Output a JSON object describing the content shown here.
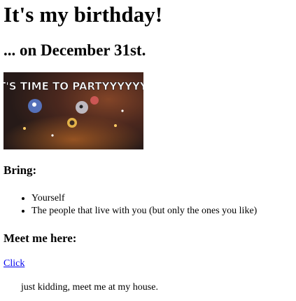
{
  "page": {
    "heading": "It's my birthday!",
    "subheading": "... on December 31st.",
    "banner": {
      "text": "IT'S TIME TO PARTYYYYYY!",
      "colors": {
        "background": "#3a2a22",
        "text": "#ffffff",
        "glow": "#f08a2a",
        "accent": "#5a7fd6"
      }
    },
    "bring": {
      "heading": "Bring:",
      "items": [
        "Yourself",
        "The people that live with you (but only the ones you like)"
      ]
    },
    "meet": {
      "heading": "Meet me here:",
      "link_text": "Click",
      "note": "just kidding, meet me at my house."
    }
  }
}
